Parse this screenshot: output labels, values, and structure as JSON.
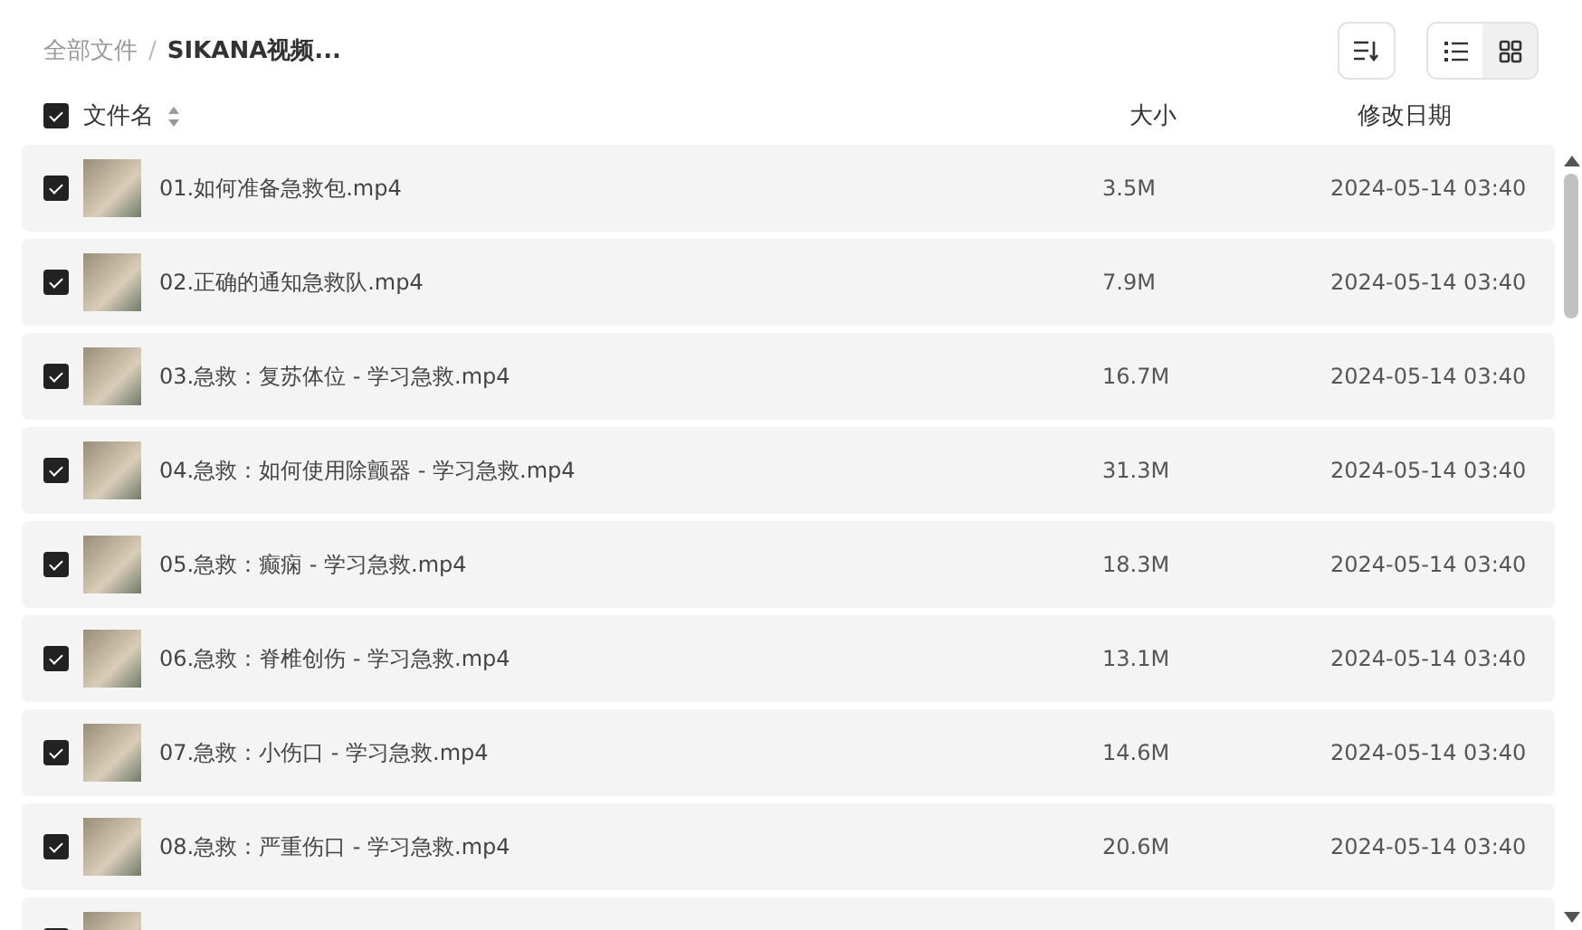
{
  "breadcrumb_separator": "/",
  "breadcrumb": [
    {
      "label": "全部文件",
      "current": false
    },
    {
      "label": "SIKANA视频...",
      "current": true
    }
  ],
  "view_toggle": [
    {
      "kind": "list",
      "selected": true
    },
    {
      "kind": "grid",
      "selected": false
    }
  ],
  "header": {
    "checked": true,
    "columns": [
      "文件名",
      "大小",
      "修改日期"
    ]
  },
  "rows": [
    {
      "checked": true,
      "name": "01.如何准备急救包.mp4",
      "size": "3.5M",
      "date": "2024-05-14 03:40"
    },
    {
      "checked": true,
      "name": "02.正确的通知急救队.mp4",
      "size": "7.9M",
      "date": "2024-05-14 03:40"
    },
    {
      "checked": true,
      "name": "03.急救：复苏体位 - 学习急救.mp4",
      "size": "16.7M",
      "date": "2024-05-14 03:40"
    },
    {
      "checked": true,
      "name": "04.急救：如何使用除颤器 - 学习急救.mp4",
      "size": "31.3M",
      "date": "2024-05-14 03:40"
    },
    {
      "checked": true,
      "name": "05.急救：癫痫 - 学习急救.mp4",
      "size": "18.3M",
      "date": "2024-05-14 03:40"
    },
    {
      "checked": true,
      "name": "06.急救：脊椎创伤 - 学习急救.mp4",
      "size": "13.1M",
      "date": "2024-05-14 03:40"
    },
    {
      "checked": true,
      "name": "07.急救：小伤口 - 学习急救.mp4",
      "size": "14.6M",
      "date": "2024-05-14 03:40"
    },
    {
      "checked": true,
      "name": "08.急救：严重伤口 - 学习急救.mp4",
      "size": "20.6M",
      "date": "2024-05-14 03:40"
    },
    {
      "checked": true
    }
  ]
}
